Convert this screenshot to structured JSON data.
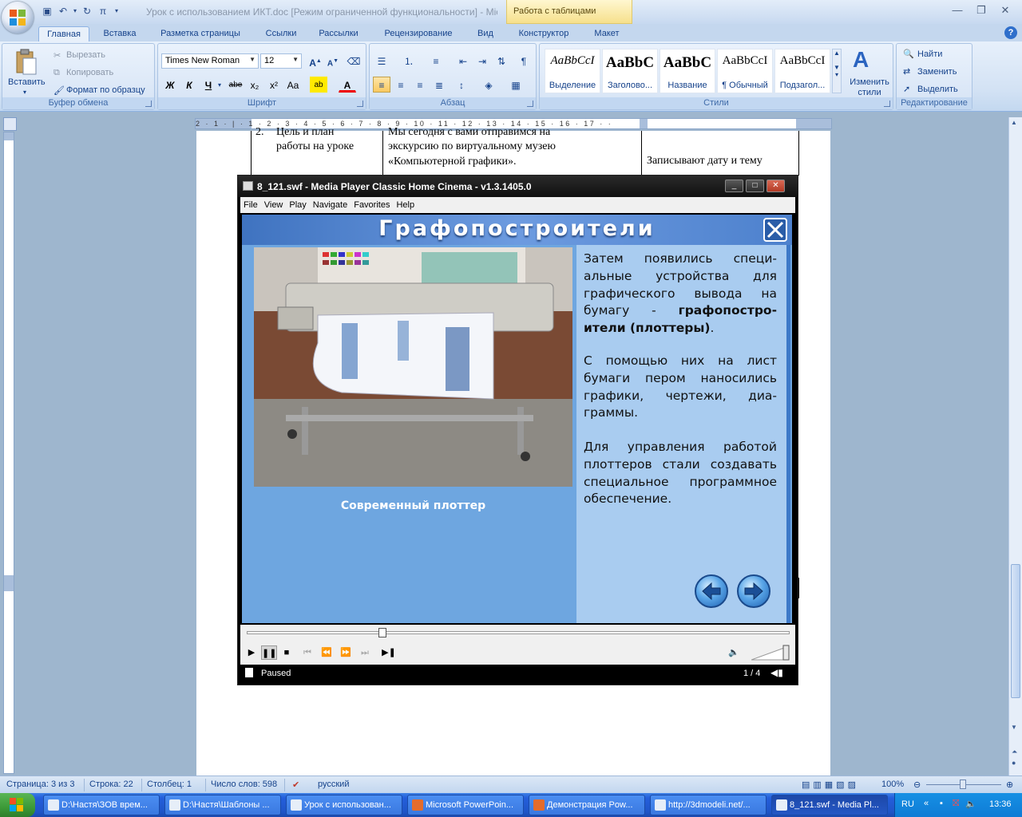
{
  "word": {
    "title": "Урок с использованием ИКТ.doc [Режим ограниченной функциональности] - Microsoft Word",
    "context_tab_header": "Работа с таблицами",
    "tabs": [
      "Главная",
      "Вставка",
      "Разметка страницы",
      "Ссылки",
      "Рассылки",
      "Рецензирование",
      "Вид",
      "Конструктор",
      "Макет"
    ],
    "active_tab": "Главная",
    "clipboard": {
      "paste": "Вставить",
      "cut": "Вырезать",
      "copy": "Копировать",
      "format_painter": "Формат по образцу",
      "label": "Буфер обмена"
    },
    "font": {
      "name": "Times New Roman",
      "size": "12",
      "label": "Шрифт",
      "bold": "Ж",
      "italic": "К",
      "underline": "Ч",
      "strike": "abe",
      "sub": "x₂",
      "sup": "x²",
      "case": "Aa"
    },
    "paragraph": {
      "label": "Абзац"
    },
    "styles": {
      "label": "Стили",
      "items": [
        {
          "preview": "AaBbCcI",
          "name": "Выделение"
        },
        {
          "preview": "AaBbC",
          "name": "Заголово..."
        },
        {
          "preview": "AaBbC",
          "name": "Название"
        },
        {
          "preview": "AaBbCcI",
          "name": "¶ Обычный"
        },
        {
          "preview": "AaBbCcI",
          "name": "Подзагол..."
        }
      ],
      "change": "Изменить стили"
    },
    "editing": {
      "find": "Найти",
      "replace": "Заменить",
      "select": "Выделить",
      "label": "Редактирование"
    },
    "ruler_numbers": "2 · 1 · | · 1 · 2 · 3 · 4 · 5 · 6 · 7 · 8 · 9 · 10 · 11 · 12 · 13 · 14 · 15 · 16 · 17 · ·",
    "doc": {
      "cell_num": "2.",
      "cell1_l1": "Цель и план",
      "cell1_l2": "работы на уроке",
      "cell2_l1": "Мы сегодня с вами отправимся на",
      "cell2_l2": "экскурсию по виртуальному музею",
      "cell2_l3": "«Компьютерной графики».",
      "cell3_l1": "Записывают дату и тему"
    },
    "status": {
      "page": "Страница: 3 из 3",
      "line": "Строка: 22",
      "column": "Столбец: 1",
      "words": "Число слов: 598",
      "lang": "русский",
      "zoom": "100%"
    }
  },
  "mpc": {
    "title": "8_121.swf - Media Player Classic Home Cinema - v1.3.1405.0",
    "menu": [
      "File",
      "View",
      "Play",
      "Navigate",
      "Favorites",
      "Help"
    ],
    "slide": {
      "heading": "Графопостроители",
      "p1_start": "Затем появились специ-альные устройства для графического вывода на бумагу - ",
      "p1_bold": "графопостро-ители (плоттеры)",
      "p1_end": ".",
      "p2": "С помощью них на лист бумаги пером наносились графики, чертежи, диа-граммы.",
      "p3": "Для управления работой плоттеров стали создавать специальное программное обеспечение.",
      "caption": "Современный плоттер"
    },
    "status": "Paused",
    "counter": "1 / 4",
    "seek_position": 0.25,
    "volume": 1.0
  },
  "taskbar": {
    "start": "пуск",
    "items": [
      {
        "label": "D:\\Настя\\ЗОВ врем...",
        "active": false
      },
      {
        "label": "D:\\Настя\\Шаблоны ...",
        "active": false
      },
      {
        "label": "Урок с использован...",
        "active": false
      },
      {
        "label": "Microsoft PowerPoin...",
        "active": false
      },
      {
        "label": "Демонстрация Pow...",
        "active": false
      },
      {
        "label": "http://3dmodeli.net/...",
        "active": false
      },
      {
        "label": "8_121.swf - Media Pl...",
        "active": true
      }
    ],
    "lang": "RU",
    "clock": "13:36"
  },
  "colors": {
    "ribbon": "#d3e2f4",
    "slide_bg": "#6ea6e0",
    "slide_panel": "#a9ccf0",
    "taskbar": "#245edb"
  }
}
